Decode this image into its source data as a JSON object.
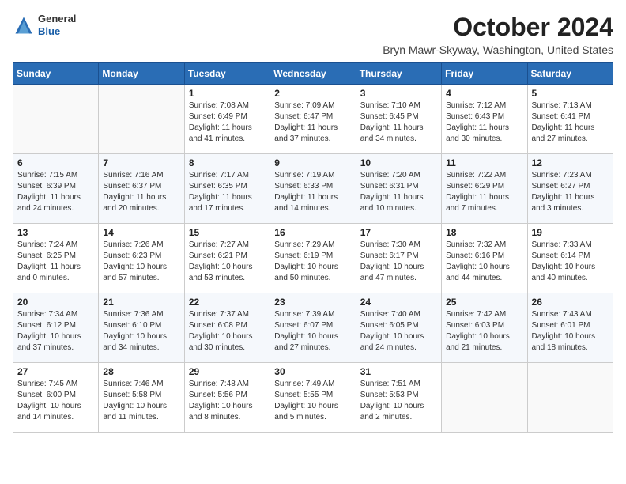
{
  "header": {
    "logo_line1": "General",
    "logo_line2": "Blue",
    "month_title": "October 2024",
    "location": "Bryn Mawr-Skyway, Washington, United States"
  },
  "days_of_week": [
    "Sunday",
    "Monday",
    "Tuesday",
    "Wednesday",
    "Thursday",
    "Friday",
    "Saturday"
  ],
  "weeks": [
    [
      {
        "day": "",
        "info": ""
      },
      {
        "day": "",
        "info": ""
      },
      {
        "day": "1",
        "info": "Sunrise: 7:08 AM\nSunset: 6:49 PM\nDaylight: 11 hours and 41 minutes."
      },
      {
        "day": "2",
        "info": "Sunrise: 7:09 AM\nSunset: 6:47 PM\nDaylight: 11 hours and 37 minutes."
      },
      {
        "day": "3",
        "info": "Sunrise: 7:10 AM\nSunset: 6:45 PM\nDaylight: 11 hours and 34 minutes."
      },
      {
        "day": "4",
        "info": "Sunrise: 7:12 AM\nSunset: 6:43 PM\nDaylight: 11 hours and 30 minutes."
      },
      {
        "day": "5",
        "info": "Sunrise: 7:13 AM\nSunset: 6:41 PM\nDaylight: 11 hours and 27 minutes."
      }
    ],
    [
      {
        "day": "6",
        "info": "Sunrise: 7:15 AM\nSunset: 6:39 PM\nDaylight: 11 hours and 24 minutes."
      },
      {
        "day": "7",
        "info": "Sunrise: 7:16 AM\nSunset: 6:37 PM\nDaylight: 11 hours and 20 minutes."
      },
      {
        "day": "8",
        "info": "Sunrise: 7:17 AM\nSunset: 6:35 PM\nDaylight: 11 hours and 17 minutes."
      },
      {
        "day": "9",
        "info": "Sunrise: 7:19 AM\nSunset: 6:33 PM\nDaylight: 11 hours and 14 minutes."
      },
      {
        "day": "10",
        "info": "Sunrise: 7:20 AM\nSunset: 6:31 PM\nDaylight: 11 hours and 10 minutes."
      },
      {
        "day": "11",
        "info": "Sunrise: 7:22 AM\nSunset: 6:29 PM\nDaylight: 11 hours and 7 minutes."
      },
      {
        "day": "12",
        "info": "Sunrise: 7:23 AM\nSunset: 6:27 PM\nDaylight: 11 hours and 3 minutes."
      }
    ],
    [
      {
        "day": "13",
        "info": "Sunrise: 7:24 AM\nSunset: 6:25 PM\nDaylight: 11 hours and 0 minutes."
      },
      {
        "day": "14",
        "info": "Sunrise: 7:26 AM\nSunset: 6:23 PM\nDaylight: 10 hours and 57 minutes."
      },
      {
        "day": "15",
        "info": "Sunrise: 7:27 AM\nSunset: 6:21 PM\nDaylight: 10 hours and 53 minutes."
      },
      {
        "day": "16",
        "info": "Sunrise: 7:29 AM\nSunset: 6:19 PM\nDaylight: 10 hours and 50 minutes."
      },
      {
        "day": "17",
        "info": "Sunrise: 7:30 AM\nSunset: 6:17 PM\nDaylight: 10 hours and 47 minutes."
      },
      {
        "day": "18",
        "info": "Sunrise: 7:32 AM\nSunset: 6:16 PM\nDaylight: 10 hours and 44 minutes."
      },
      {
        "day": "19",
        "info": "Sunrise: 7:33 AM\nSunset: 6:14 PM\nDaylight: 10 hours and 40 minutes."
      }
    ],
    [
      {
        "day": "20",
        "info": "Sunrise: 7:34 AM\nSunset: 6:12 PM\nDaylight: 10 hours and 37 minutes."
      },
      {
        "day": "21",
        "info": "Sunrise: 7:36 AM\nSunset: 6:10 PM\nDaylight: 10 hours and 34 minutes."
      },
      {
        "day": "22",
        "info": "Sunrise: 7:37 AM\nSunset: 6:08 PM\nDaylight: 10 hours and 30 minutes."
      },
      {
        "day": "23",
        "info": "Sunrise: 7:39 AM\nSunset: 6:07 PM\nDaylight: 10 hours and 27 minutes."
      },
      {
        "day": "24",
        "info": "Sunrise: 7:40 AM\nSunset: 6:05 PM\nDaylight: 10 hours and 24 minutes."
      },
      {
        "day": "25",
        "info": "Sunrise: 7:42 AM\nSunset: 6:03 PM\nDaylight: 10 hours and 21 minutes."
      },
      {
        "day": "26",
        "info": "Sunrise: 7:43 AM\nSunset: 6:01 PM\nDaylight: 10 hours and 18 minutes."
      }
    ],
    [
      {
        "day": "27",
        "info": "Sunrise: 7:45 AM\nSunset: 6:00 PM\nDaylight: 10 hours and 14 minutes."
      },
      {
        "day": "28",
        "info": "Sunrise: 7:46 AM\nSunset: 5:58 PM\nDaylight: 10 hours and 11 minutes."
      },
      {
        "day": "29",
        "info": "Sunrise: 7:48 AM\nSunset: 5:56 PM\nDaylight: 10 hours and 8 minutes."
      },
      {
        "day": "30",
        "info": "Sunrise: 7:49 AM\nSunset: 5:55 PM\nDaylight: 10 hours and 5 minutes."
      },
      {
        "day": "31",
        "info": "Sunrise: 7:51 AM\nSunset: 5:53 PM\nDaylight: 10 hours and 2 minutes."
      },
      {
        "day": "",
        "info": ""
      },
      {
        "day": "",
        "info": ""
      }
    ]
  ]
}
